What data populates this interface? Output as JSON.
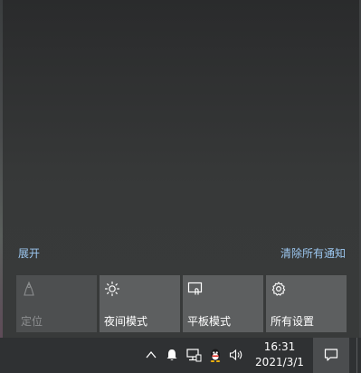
{
  "action_center": {
    "expand_label": "展开",
    "clear_all_label": "清除所有通知",
    "quick_actions": [
      {
        "label": "定位",
        "icon": "location-icon",
        "enabled": false
      },
      {
        "label": "夜间模式",
        "icon": "brightness-icon",
        "enabled": true
      },
      {
        "label": "平板模式",
        "icon": "tablet-mode-icon",
        "enabled": true
      },
      {
        "label": "所有设置",
        "icon": "settings-gear-icon",
        "enabled": true
      }
    ]
  },
  "taskbar": {
    "tray_icons": [
      "chevron-up-icon",
      "bell-icon",
      "network-icon",
      "qq-icon",
      "volume-icon"
    ],
    "time": "16:31",
    "date": "2021/3/1",
    "notification_button_icon": "action-center-icon"
  },
  "colors": {
    "link": "#9cc7f0",
    "tile": "#5d5f60",
    "tile_disabled": "#4d4f50",
    "taskbar": "#2f3133"
  }
}
